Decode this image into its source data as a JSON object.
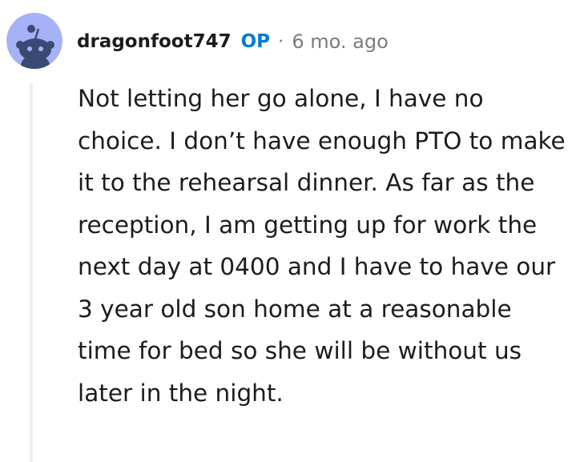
{
  "comment": {
    "author": "dragonfoot747",
    "op_badge": "OP",
    "separator": "·",
    "age": "6 mo. ago",
    "avatar_icon": "reddit-snoo-avatar-icon",
    "body": "Not letting her go alone, I have no choice. I don’t have enough PTO to make it to the rehearsal dinner. As far as the reception, I am getting up for work the next day at 0400 and I have to have our 3 year old son home at a reasonable time for bed so she will be without us later in the night."
  },
  "colors": {
    "avatar_bg": "#a5b2f5",
    "op_blue": "#0079d3",
    "meta_gray": "#7c7c7c",
    "thread_line": "#edeff1",
    "text": "#1c1c1c"
  }
}
